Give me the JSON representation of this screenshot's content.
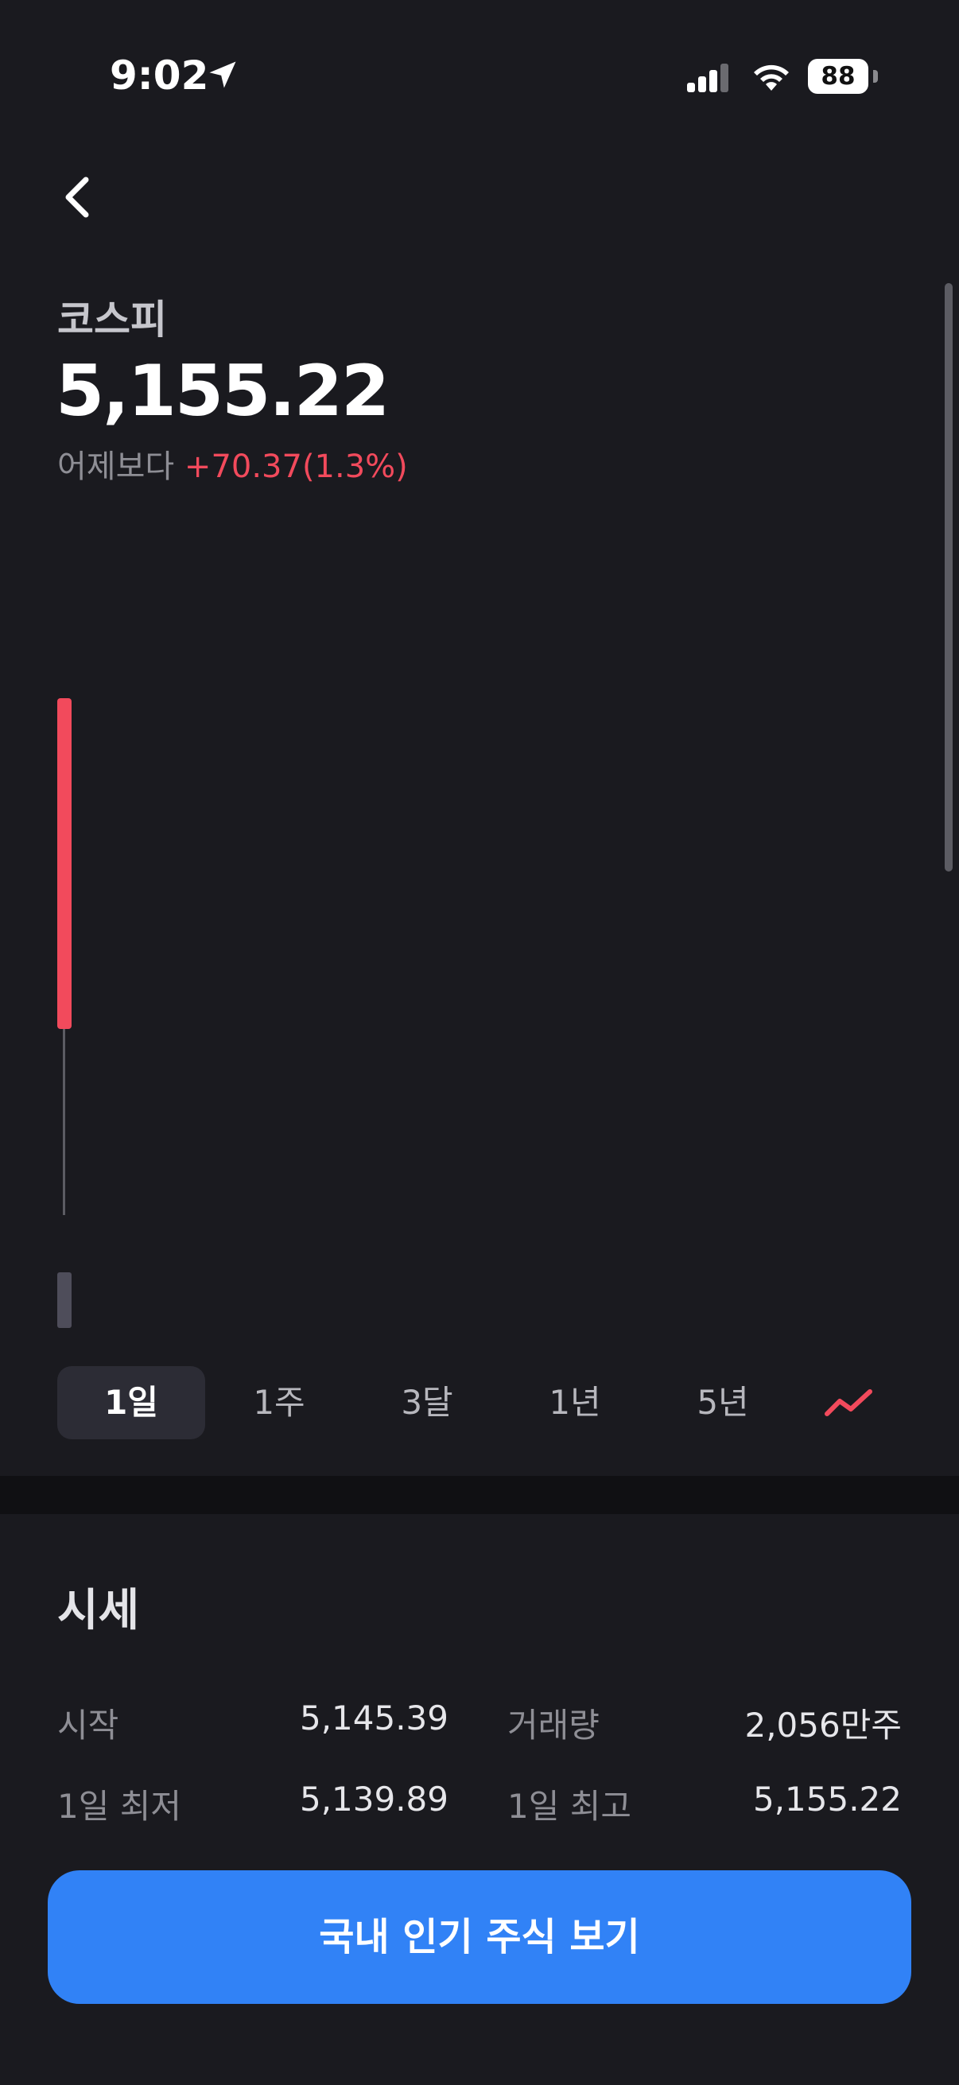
{
  "status_bar": {
    "time": "9:02",
    "battery_level": "88",
    "icons": [
      "location-arrow-icon",
      "cellular-signal-icon",
      "wifi-icon",
      "battery-icon"
    ]
  },
  "header": {
    "index_name": "코스피",
    "price": "5,155.22",
    "change_label": "어제보다",
    "change_value": "+70.37(1.3%)"
  },
  "chart": {
    "candle_color": "#f24a5c",
    "volume_color": "#4e4d5a"
  },
  "periods": {
    "items": [
      "1일",
      "1주",
      "3달",
      "1년",
      "5년"
    ],
    "selected": "1일",
    "chart_type_icon": "line-chart-icon"
  },
  "quote": {
    "title": "시세",
    "rows": [
      {
        "label": "시작",
        "value": "5,145.39"
      },
      {
        "label": "거래량",
        "value": "2,056만주"
      },
      {
        "label": "1일 최저",
        "value": "5,139.89"
      },
      {
        "label": "1일 최고",
        "value": "5,155.22"
      }
    ]
  },
  "cta": {
    "label": "국내 인기 주식 보기"
  },
  "colors": {
    "background": "#1a1a1f",
    "up_red": "#f24a5c",
    "accent_blue": "#3182f6"
  }
}
